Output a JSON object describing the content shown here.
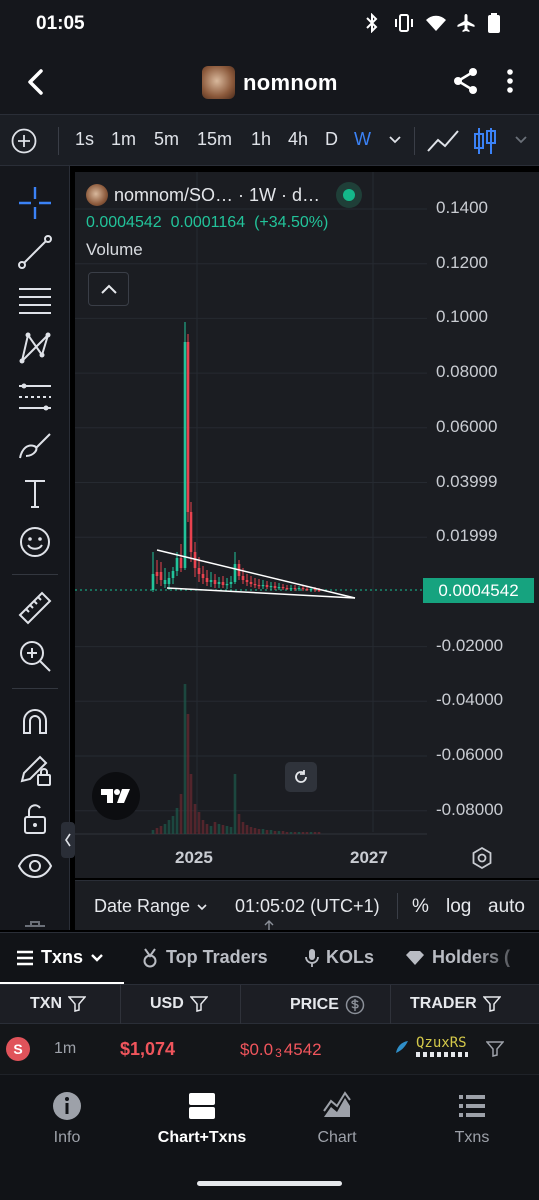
{
  "status_bar": {
    "time": "01:05"
  },
  "app_bar": {
    "title": "nomnom"
  },
  "toolbar": {
    "intervals": [
      "1s",
      "1m",
      "5m",
      "15m",
      "1h",
      "4h",
      "D",
      "W"
    ],
    "active_interval": "W"
  },
  "chart": {
    "legend": {
      "symbol_text": "nomnom/SO… · 1W · d…",
      "price": "0.0004542",
      "change": "0.0001164",
      "change_pct": "(+34.50%)",
      "volume_label": "Volume"
    },
    "current_price_tag": "0.0004542",
    "y_axis_labels": [
      "0.1400",
      "0.1200",
      "0.1000",
      "0.08000",
      "0.06000",
      "0.03999",
      "0.01999",
      "-0.02000",
      "-0.04000",
      "-0.06000",
      "-0.08000"
    ],
    "x_axis_labels": [
      "2025",
      "2027"
    ],
    "colors": {
      "up": "#22c39a",
      "down": "#e8424f",
      "price_line": "#16a37f",
      "background": "#1b1d22"
    }
  },
  "date_bar": {
    "date_range_label": "Date Range",
    "time": "01:05:02 (UTC+1)",
    "percent": "%",
    "log": "log",
    "auto": "auto"
  },
  "tabs": [
    {
      "label": "Txns",
      "icon": "list-icon"
    },
    {
      "label": "Top Traders",
      "icon": "medal-icon"
    },
    {
      "label": "KOLs",
      "icon": "microphone-icon"
    },
    {
      "label": "Holders (",
      "icon": "diamond-icon"
    }
  ],
  "table": {
    "headers": [
      "TXN",
      "USD",
      "PRICE",
      "TRADER"
    ],
    "rows": [
      {
        "type": "S",
        "age": "1m",
        "usd": "$1,074",
        "price_prefix": "$0.0",
        "price_zeros": "3",
        "price_digits": "4542",
        "trader": "QzuxRS"
      }
    ]
  },
  "bottom_nav": {
    "items": [
      {
        "label": "Info",
        "icon": "info-icon"
      },
      {
        "label": "Chart+Txns",
        "icon": "split-view-icon"
      },
      {
        "label": "Chart",
        "icon": "area-chart-icon"
      },
      {
        "label": "Txns",
        "icon": "list-icon"
      }
    ],
    "active": "Chart+Txns"
  }
}
